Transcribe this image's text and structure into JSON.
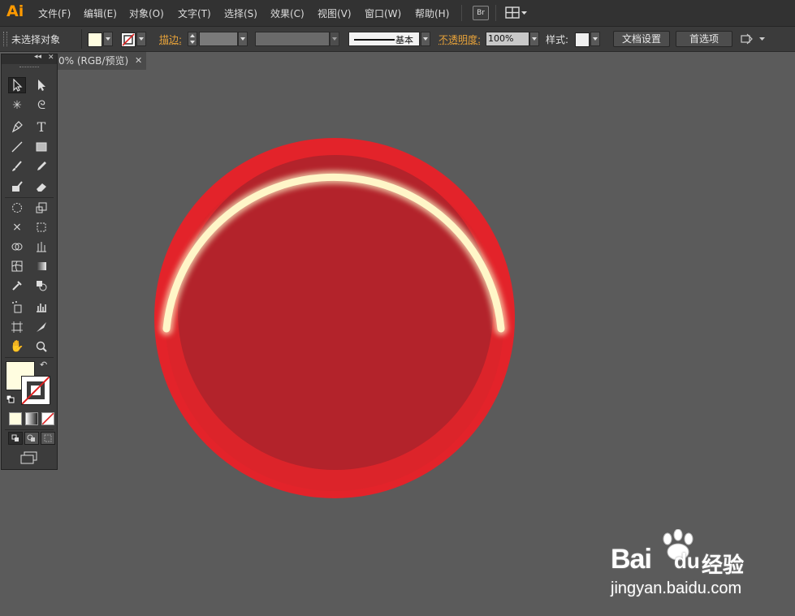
{
  "app": {
    "logo": "Ai",
    "bridge_label": "Br"
  },
  "menu": [
    "文件(F)",
    "编辑(E)",
    "对象(O)",
    "文字(T)",
    "选择(S)",
    "效果(C)",
    "视图(V)",
    "窗口(W)",
    "帮助(H)"
  ],
  "control": {
    "selection_status": "未选择对象",
    "fill_color": "#fffde0",
    "stroke_label": "描边:",
    "stroke_profile": "基本",
    "opacity_label": "不透明度:",
    "opacity_value": "100%",
    "style_label": "样式:",
    "doc_setup_button": "文档设置",
    "preferences_button": "首选项"
  },
  "document": {
    "tab_title": "0% (RGB/预览)"
  },
  "artwork": {
    "outer_color": "#e3232a",
    "inner_color": "#b3232b",
    "highlight_color": "#fff6c8"
  },
  "watermark": {
    "brand": "Bai",
    "brand_tail": "du",
    "brand_cn": "经验",
    "url": "jingyan.baidu.com"
  }
}
